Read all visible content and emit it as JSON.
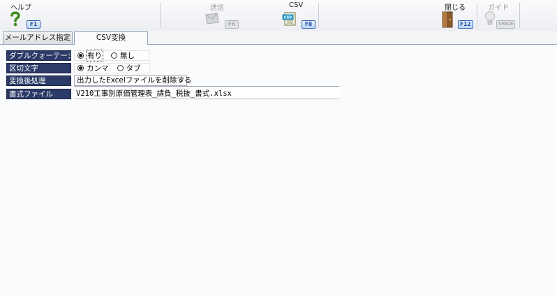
{
  "toolbar": {
    "help": {
      "label": "ヘルプ",
      "key": "F1",
      "icon": "help-question-icon"
    },
    "send": {
      "label": "送信",
      "key": "F6",
      "icon": "send-mail-icon",
      "enabled": false
    },
    "csv": {
      "label": "CSV",
      "key": "F8",
      "icon": "csv-file-icon"
    },
    "close": {
      "label": "閉じる",
      "key": "F12",
      "icon": "door-close-icon"
    },
    "guide": {
      "label": "ガイド",
      "key": "SPACE",
      "icon": "lightbulb-guide-icon",
      "enabled": false
    }
  },
  "tabs": [
    {
      "label": "メールアドレス指定",
      "active": false
    },
    {
      "label": "CSV変換",
      "active": true
    }
  ],
  "form": {
    "quote": {
      "label": "ダブルクォーテーション",
      "options": [
        "有り",
        "無し"
      ],
      "selected": "有り"
    },
    "delimiter": {
      "label": "区切文字",
      "options": [
        "カンマ",
        "タブ"
      ],
      "selected": "カンマ"
    },
    "post_process": {
      "label": "変換後処理",
      "value": "出力したExcelファイルを削除する"
    },
    "format_file": {
      "label": "書式ファイル",
      "value": "V210工事別原価管理表_請負_税抜_書式.xlsx"
    }
  },
  "colors": {
    "label_bg": "#2b3a67",
    "fkey_border": "#2f64b4",
    "panel_bg": "#fafbfd"
  }
}
